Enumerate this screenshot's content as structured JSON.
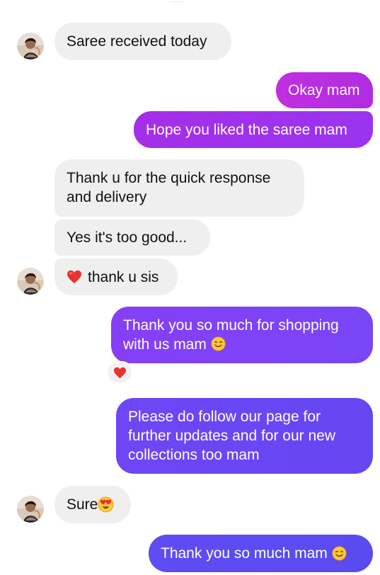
{
  "header": {
    "fragment": "......"
  },
  "messages": [
    {
      "id": "m1",
      "direction": "incoming",
      "text": "Saree received today"
    },
    {
      "id": "m2",
      "direction": "outgoing",
      "text": "Okay mam"
    },
    {
      "id": "m3",
      "direction": "outgoing",
      "text": "Hope you liked the saree mam"
    },
    {
      "id": "m4",
      "direction": "incoming",
      "text": "Thank u for the quick response and delivery"
    },
    {
      "id": "m5",
      "direction": "incoming",
      "text": "Yes it's too good..."
    },
    {
      "id": "m6",
      "direction": "incoming",
      "text": "thank u sis",
      "leading_icon": "red-heart-icon"
    },
    {
      "id": "m7",
      "direction": "outgoing",
      "text": "Thank you so much for shopping with us mam",
      "trailing_icon": "smiling-face-icon",
      "reaction": "red-heart-icon"
    },
    {
      "id": "m8",
      "direction": "outgoing",
      "text": "Please do follow our page for further updates and for our new collections too mam"
    },
    {
      "id": "m9",
      "direction": "incoming",
      "text": "Sure",
      "trailing_icon": "heart-eyes-icon"
    },
    {
      "id": "m10",
      "direction": "outgoing",
      "text": "Thank you so much mam",
      "trailing_icon": "smiling-face-icon"
    }
  ],
  "colors": {
    "incoming_bubble": "#efefef",
    "outgoing_gradient_magenta": "#b02ee0",
    "outgoing_gradient_violet": "#7b3cf5",
    "outgoing_gradient_blue": "#6249f2"
  }
}
